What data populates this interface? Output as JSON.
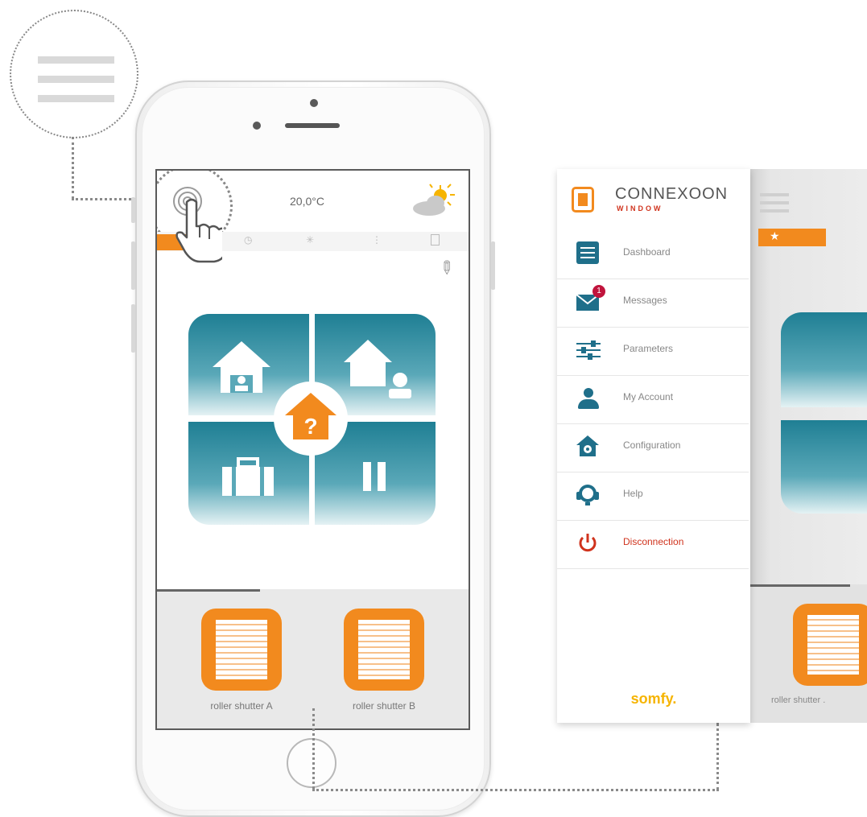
{
  "phone": {
    "temperature": "20,0°C",
    "tabs": [
      "favorites",
      "clock",
      "sun",
      "info",
      "trash"
    ],
    "devices": [
      {
        "label": "roller shutter A"
      },
      {
        "label": "roller shutter B"
      }
    ]
  },
  "menu": {
    "brand": "CONNEXOON",
    "brand_sub": "WINDOW",
    "items": [
      {
        "label": "Dashboard",
        "icon": "dashboard-icon"
      },
      {
        "label": "Messages",
        "icon": "envelope-icon",
        "badge": "1"
      },
      {
        "label": "Parameters",
        "icon": "sliders-icon"
      },
      {
        "label": "My Account",
        "icon": "user-icon"
      },
      {
        "label": "Configuration",
        "icon": "home-gear-icon"
      },
      {
        "label": "Help",
        "icon": "headset-icon"
      },
      {
        "label": "Disconnection",
        "icon": "power-icon"
      }
    ],
    "footer_logo": "somfy.",
    "preview_device_label": "roller shutter ."
  },
  "colors": {
    "accent": "#f28a1e",
    "teal": "#1f7f94",
    "disconnect": "#d0331d"
  }
}
